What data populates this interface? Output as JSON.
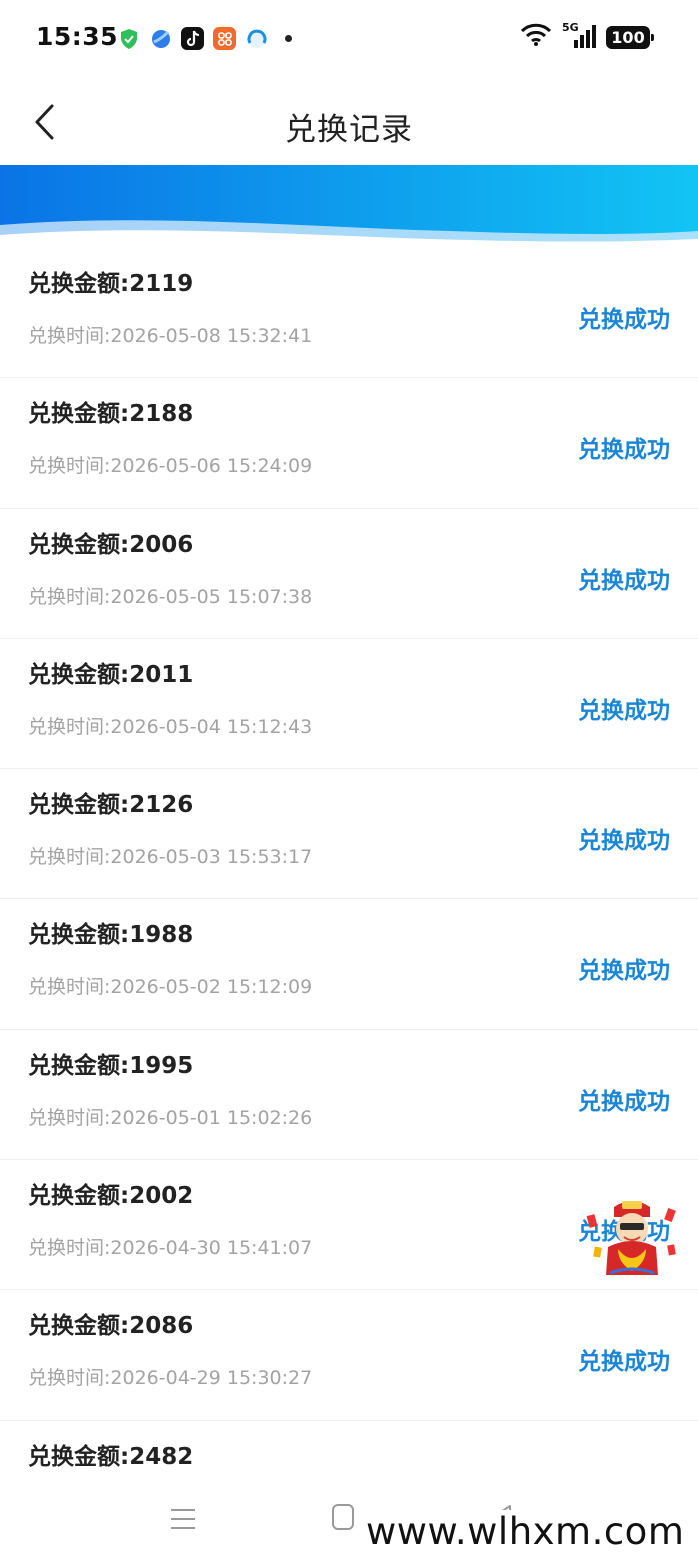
{
  "status_bar": {
    "time": "15:35",
    "network": "5G",
    "battery": "100"
  },
  "header": {
    "title": "兑换记录"
  },
  "records": [
    {
      "amount": "兑换金额:2119",
      "time": "兑换时间:2026-05-08 15:32:41",
      "status": "兑换成功"
    },
    {
      "amount": "兑换金额:2188",
      "time": "兑换时间:2026-05-06 15:24:09",
      "status": "兑换成功"
    },
    {
      "amount": "兑换金额:2006",
      "time": "兑换时间:2026-05-05 15:07:38",
      "status": "兑换成功"
    },
    {
      "amount": "兑换金额:2011",
      "time": "兑换时间:2026-05-04 15:12:43",
      "status": "兑换成功"
    },
    {
      "amount": "兑换金额:2126",
      "time": "兑换时间:2026-05-03 15:53:17",
      "status": "兑换成功"
    },
    {
      "amount": "兑换金额:1988",
      "time": "兑换时间:2026-05-02 15:12:09",
      "status": "兑换成功"
    },
    {
      "amount": "兑换金额:1995",
      "time": "兑换时间:2026-05-01 15:02:26",
      "status": "兑换成功"
    },
    {
      "amount": "兑换金额:2002",
      "time": "兑换时间:2026-04-30 15:41:07",
      "status": "兑换成功"
    },
    {
      "amount": "兑换金额:2086",
      "time": "兑换时间:2026-04-29 15:30:27",
      "status": "兑换成功"
    },
    {
      "amount": "兑换金额:2482",
      "time": "",
      "status": ""
    }
  ],
  "colors": {
    "status_text": "#1c86d6",
    "banner_start": "#0a74e6",
    "banner_end": "#12c4f4"
  },
  "watermark": "www.wlhxm.com"
}
